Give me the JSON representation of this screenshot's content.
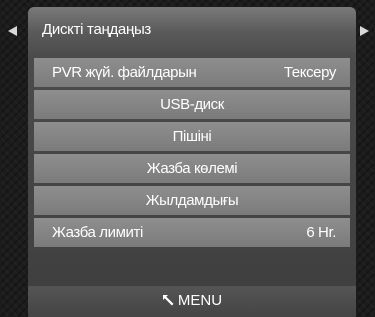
{
  "header": {
    "title": "Дискті таңдаңыз"
  },
  "menu": {
    "items": [
      {
        "label": "PVR жүй. файлдарын",
        "value": "Тексеру"
      },
      {
        "label": "USB-диск"
      },
      {
        "label": "Пішіні"
      },
      {
        "label": "Жазба көлемі"
      },
      {
        "label": "Жылдамдығы"
      },
      {
        "label": "Жазба лимиті",
        "value": "6 Hr."
      }
    ]
  },
  "footer": {
    "return_icon": "return-arrow-icon",
    "label": "MENU"
  },
  "nav": {
    "left_icon": "triangle-left-icon",
    "right_icon": "triangle-right-icon"
  }
}
